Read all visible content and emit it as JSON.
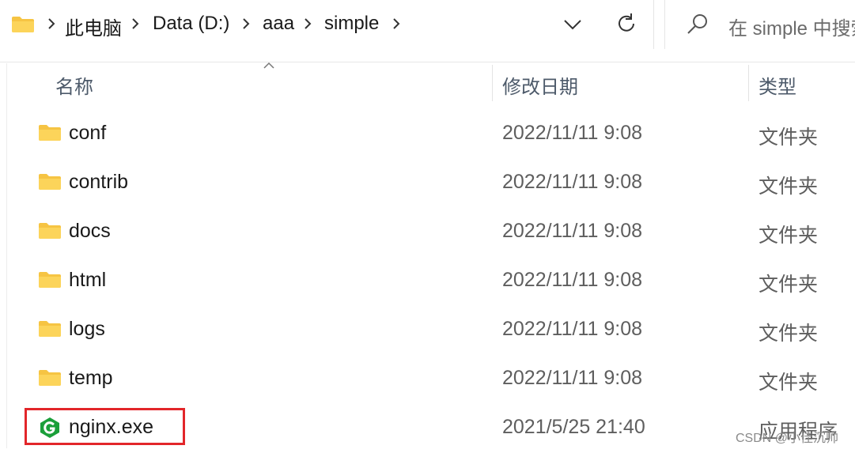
{
  "address_bar": {
    "breadcrumbs": [
      "此电脑",
      "Data (D:)",
      "aaa",
      "simple"
    ],
    "folder_icon": "folder-icon",
    "dropdown_icon": "chevron-down-icon",
    "refresh_icon": "refresh-icon"
  },
  "search": {
    "placeholder": "在 simple 中搜索",
    "icon": "search-icon"
  },
  "columns": {
    "name": "名称",
    "date": "修改日期",
    "type": "类型"
  },
  "files": [
    {
      "name": "conf",
      "date": "2022/11/11 9:08",
      "type": "文件夹",
      "icon": "folder-icon"
    },
    {
      "name": "contrib",
      "date": "2022/11/11 9:08",
      "type": "文件夹",
      "icon": "folder-icon"
    },
    {
      "name": "docs",
      "date": "2022/11/11 9:08",
      "type": "文件夹",
      "icon": "folder-icon"
    },
    {
      "name": "html",
      "date": "2022/11/11 9:08",
      "type": "文件夹",
      "icon": "folder-icon"
    },
    {
      "name": "logs",
      "date": "2022/11/11 9:08",
      "type": "文件夹",
      "icon": "folder-icon"
    },
    {
      "name": "temp",
      "date": "2022/11/11 9:08",
      "type": "文件夹",
      "icon": "folder-icon"
    },
    {
      "name": "nginx.exe",
      "date": "2021/5/25 21:40",
      "type": "应用程序",
      "icon": "nginx-app-icon"
    }
  ],
  "colors": {
    "folder": "#f6c443",
    "nginx": "#1b9f3a",
    "highlight": "#e2262a"
  },
  "watermark": "CSDN @小佳沉帅"
}
